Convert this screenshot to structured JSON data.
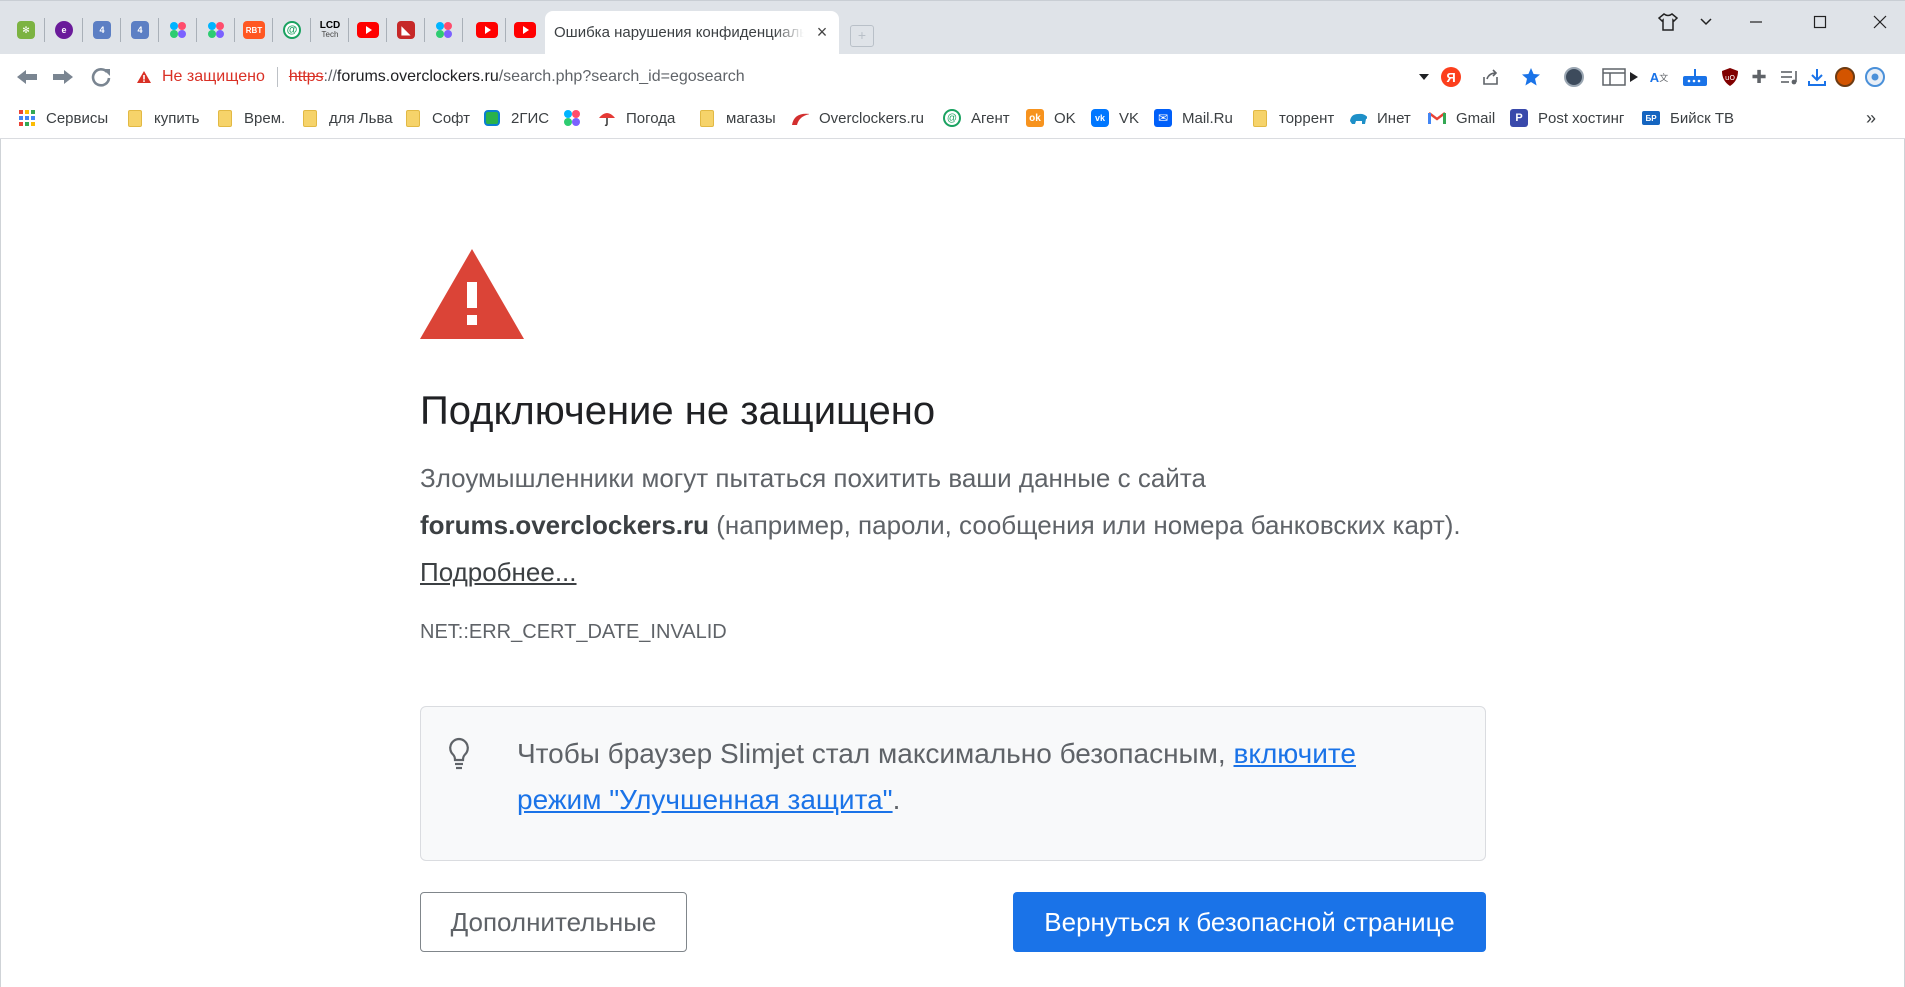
{
  "tabs": {
    "active_title": "Ошибка нарушения конфиденциальности",
    "pinned_icons": [
      "gear-flower-icon",
      "edge-e-icon",
      "reader-4-icon",
      "reader-4-icon",
      "colored-dots-icon",
      "colored-dots-icon",
      "rbt-icon",
      "at-sign-icon",
      "lcd-tech-icon",
      "youtube-icon",
      "angry-bird-icon",
      "colored-dots-icon",
      "youtube-icon",
      "youtube-icon"
    ],
    "rbt_label": "RBT",
    "lcd_label": "LCD",
    "lcd_sub": "Tech"
  },
  "toolbar": {
    "security_label": "Не защищено",
    "url_scheme": "https",
    "url_sep": "://",
    "url_host": "forums.overclockers.ru",
    "url_path": "/search.php?search_id=egosearch"
  },
  "bookmarks": [
    {
      "label": "Сервисы",
      "icon": "apps-grid-icon"
    },
    {
      "label": "купить",
      "icon": "folder-icon"
    },
    {
      "label": "Врем.",
      "icon": "folder-icon"
    },
    {
      "label": "для Льва",
      "icon": "folder-icon"
    },
    {
      "label": "Софт",
      "icon": "folder-icon"
    },
    {
      "label": "2ГИС",
      "icon": "2gis-icon"
    },
    {
      "label": "",
      "icon": "colored-dots-icon"
    },
    {
      "label": "Погода",
      "icon": "umbrella-icon"
    },
    {
      "label": "магазы",
      "icon": "folder-icon"
    },
    {
      "label": "Overclockers.ru",
      "icon": "overclockers-icon"
    },
    {
      "label": "Агент",
      "icon": "mail-agent-icon"
    },
    {
      "label": "OK",
      "icon": "odnoklassniki-icon"
    },
    {
      "label": "VK",
      "icon": "vk-icon"
    },
    {
      "label": "Mail.Ru",
      "icon": "mailru-icon"
    },
    {
      "label": "торрент",
      "icon": "folder-icon"
    },
    {
      "label": "Инет",
      "icon": "bear-icon"
    },
    {
      "label": "Gmail",
      "icon": "gmail-icon"
    },
    {
      "label": "Post хостинг",
      "icon": "post-hosting-icon"
    },
    {
      "label": "Бийск ТВ",
      "icon": "biysk-tv-icon"
    }
  ],
  "bookmarks_overflow": "»",
  "bookmark_badges": {
    "ok": "ok",
    "vk": "vk",
    "biysk": "БР"
  },
  "page": {
    "heading": "Подключение не защищено",
    "explanation_pre": "Злоумышленники могут пытаться похитить ваши данные с сайта",
    "explanation_host": "forums.overclockers.ru",
    "explanation_post": "(например, пароли, сообщения или номера банковских карт).",
    "learn_more": "Подробнее...",
    "error_code": "NET::ERR_CERT_DATE_INVALID",
    "promo_text": "Чтобы браузер Slimjet стал максимально безопасным,",
    "promo_link": "включите режим \"Улучшенная защита\"",
    "promo_end": ".",
    "details_button": "Дополнительные",
    "back_button": "Вернуться к безопасной странице"
  },
  "colors": {
    "danger": "#d93025",
    "primary": "#1a73e8",
    "text": "#202124",
    "secondary_text": "#5f6368",
    "tabstrip": "#dfe3e8",
    "promo_bg": "#f8f9fa"
  }
}
